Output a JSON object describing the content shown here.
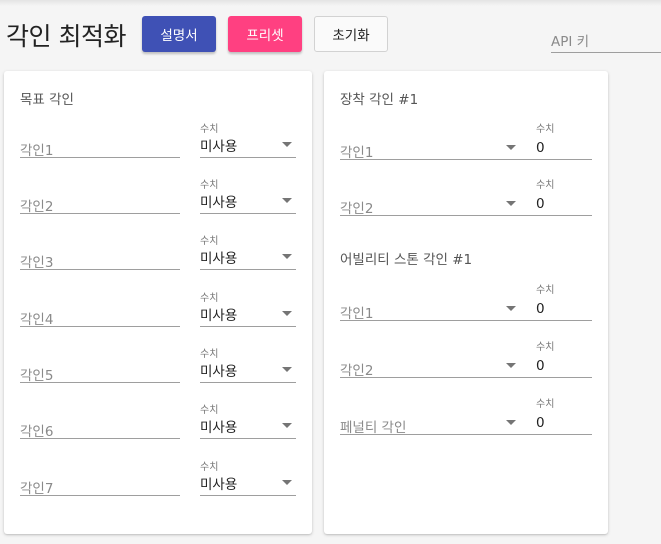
{
  "page": {
    "title": "각인 최적화",
    "buttons": {
      "manual": "설명서",
      "preset": "프리셋",
      "reset": "초기화"
    },
    "api_key_label": "API 키"
  },
  "colors": {
    "primary": "#3f51b5",
    "accent": "#ff4081"
  },
  "target": {
    "title": "목표 각인",
    "value_label": "수치",
    "rows": [
      {
        "label": "각인1",
        "value": "미사용"
      },
      {
        "label": "각인2",
        "value": "미사용"
      },
      {
        "label": "각인3",
        "value": "미사용"
      },
      {
        "label": "각인4",
        "value": "미사용"
      },
      {
        "label": "각인5",
        "value": "미사용"
      },
      {
        "label": "각인6",
        "value": "미사용"
      },
      {
        "label": "각인7",
        "value": "미사용"
      }
    ]
  },
  "equipped": {
    "title": "장착 각인 #1",
    "value_label": "수치",
    "rows": [
      {
        "label": "각인1",
        "value": "0"
      },
      {
        "label": "각인2",
        "value": "0"
      }
    ]
  },
  "ability_stone": {
    "title": "어빌리티 스톤 각인 #1",
    "value_label": "수치",
    "rows": [
      {
        "label": "각인1",
        "value": "0"
      },
      {
        "label": "각인2",
        "value": "0"
      },
      {
        "label": "페널티 각인",
        "value": "0"
      }
    ]
  }
}
